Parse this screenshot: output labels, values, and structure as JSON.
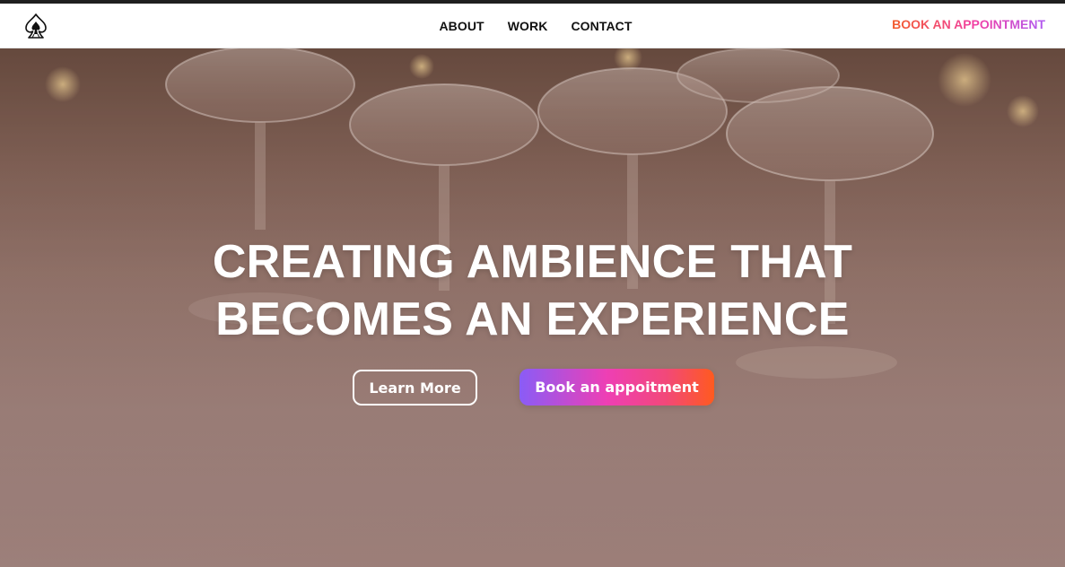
{
  "nav": {
    "links": [
      {
        "label": "ABOUT"
      },
      {
        "label": "WORK"
      },
      {
        "label": "CONTACT"
      }
    ],
    "cta_label": "BOOK AN APPOINTMENT",
    "logo_icon": "spade-icon"
  },
  "hero": {
    "title_line_1": "CREATING AMBIENCE THAT",
    "title_line_2": "BECOMES AN EXPERIENCE",
    "learn_more_label": "Learn More",
    "book_label": "Book an appoitment",
    "background_image": "champagne-coupes-photo"
  },
  "colors": {
    "cta_gradient": [
      "#f25c2a",
      "#f13fa6",
      "#b05cf2"
    ],
    "book_gradient": [
      "#8a5cf6",
      "#ee3fb4",
      "#ff5a1f"
    ],
    "nav_text": "#111111",
    "hero_text": "#ffffff"
  }
}
